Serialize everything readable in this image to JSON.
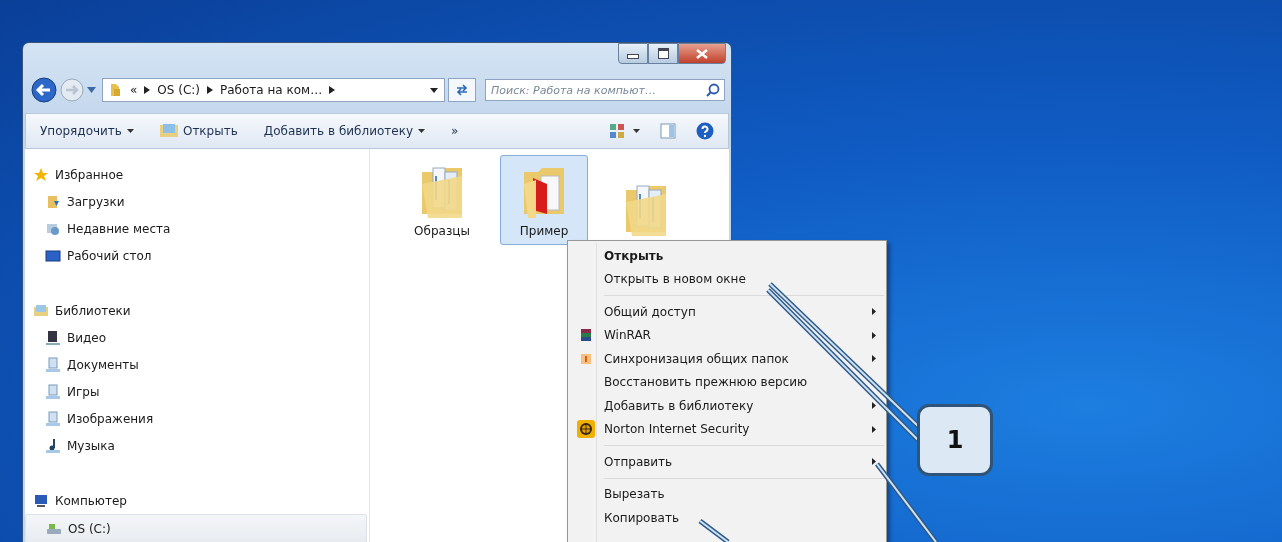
{
  "address_bar": {
    "crumbs": [
      "«",
      "OS (C:)",
      "Работа на ком…"
    ]
  },
  "search": {
    "placeholder": "Поиск: Работа на компьют…"
  },
  "toolbar": [
    {
      "label": "Упорядочить",
      "kind": "menu"
    },
    {
      "label": "Открыть",
      "kind": "icon"
    },
    {
      "label": "Добавить в библиотеку",
      "kind": "menu"
    },
    {
      "label": "»",
      "kind": "more"
    }
  ],
  "nav": [
    {
      "label": "Избранное",
      "kind": "star",
      "selected": false,
      "children": [
        {
          "label": "Загрузки",
          "kind": "download",
          "selected": false
        },
        {
          "label": "Недавние места",
          "kind": "recent",
          "selected": false
        },
        {
          "label": "Рабочий стол",
          "kind": "desktop",
          "selected": false
        }
      ]
    },
    {
      "label": "Библиотеки",
      "kind": "library",
      "selected": false,
      "children": [
        {
          "label": "Видео",
          "kind": "video",
          "selected": false
        },
        {
          "label": "Документы",
          "kind": "docs",
          "selected": false
        },
        {
          "label": "Игры",
          "kind": "docs",
          "selected": false
        },
        {
          "label": "Изображения",
          "kind": "docs",
          "selected": false
        },
        {
          "label": "Музыка",
          "kind": "music",
          "selected": false
        }
      ]
    },
    {
      "label": "Компьютер",
      "kind": "computer",
      "selected": false,
      "children": [
        {
          "label": "OS (C:)",
          "kind": "drive",
          "selected": true
        }
      ]
    }
  ],
  "folders": [
    {
      "label": "Образцы",
      "kind": "papers",
      "selected": false
    },
    {
      "label": "Пример",
      "kind": "red",
      "selected": true
    },
    {
      "kind": "papers",
      "selected": false
    }
  ],
  "context_menu": {
    "groups": [
      [
        {
          "label": "Открыть",
          "kind": "plain",
          "default": true,
          "submenu": false
        },
        {
          "label": "Открыть в новом окне",
          "kind": "plain",
          "default": false,
          "submenu": false
        }
      ],
      [
        {
          "label": "Общий доступ",
          "kind": "plain",
          "default": false,
          "submenu": true
        },
        {
          "label": "WinRAR",
          "kind": "winrar",
          "default": false,
          "submenu": true
        },
        {
          "label": "Синхронизация общих папок",
          "kind": "sync",
          "default": false,
          "submenu": true
        },
        {
          "label": "Восстановить прежнюю версию",
          "kind": "plain",
          "default": false,
          "submenu": false
        },
        {
          "label": "Добавить в библиотеку",
          "kind": "plain",
          "default": false,
          "submenu": true
        },
        {
          "label": "Norton Internet Security",
          "kind": "norton",
          "default": false,
          "submenu": true
        }
      ],
      [
        {
          "label": "Отправить",
          "kind": "plain",
          "default": false,
          "submenu": true
        }
      ],
      [
        {
          "label": "Вырезать",
          "kind": "plain",
          "default": false,
          "submenu": false
        },
        {
          "label": "Копировать",
          "kind": "plain",
          "default": false,
          "submenu": false
        }
      ]
    ]
  },
  "callouts": [
    {
      "label": "1"
    }
  ]
}
